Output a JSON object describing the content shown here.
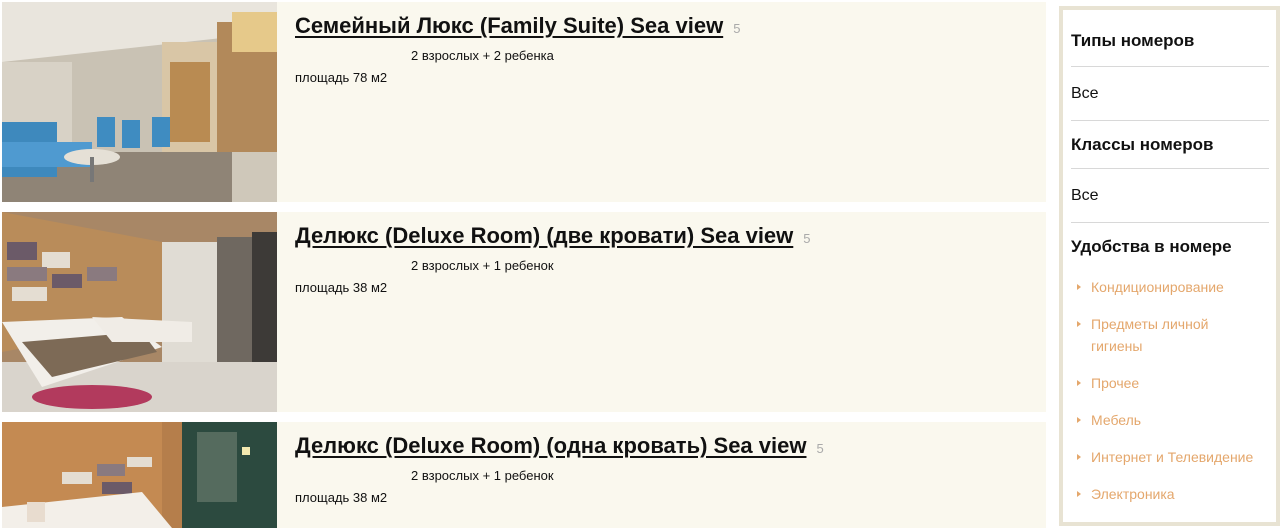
{
  "rooms": [
    {
      "title": "Семейный Люкс (Family Suite) Sea view",
      "stars": "5",
      "guests": "2 взрослых + 2 ребенка",
      "area": "площадь 78 м2"
    },
    {
      "title": "Делюкс (Deluxe Room) (две кровати) Sea view",
      "stars": "5",
      "guests": "2 взрослых + 1 ребенок",
      "area": "площадь 38 м2"
    },
    {
      "title": "Делюкс (Deluxe Room) (одна кровать) Sea view",
      "stars": "5",
      "guests": "2 взрослых + 1 ребенок",
      "area": "площадь 38 м2"
    }
  ],
  "sidebar": {
    "room_types_heading": "Типы номеров",
    "room_types_value": "Все",
    "room_classes_heading": "Классы номеров",
    "room_classes_value": "Все",
    "amenities_heading": "Удобства в номере",
    "amenities": [
      "Кондиционирование",
      "Предметы личной гигиены",
      "Прочее",
      "Мебель",
      "Интернет и Телевидение",
      "Электроника"
    ]
  },
  "colors": {
    "card_bg": "#faf8ee",
    "accent_link": "#e4a76c",
    "sidebar_border": "#e8e3d3"
  }
}
